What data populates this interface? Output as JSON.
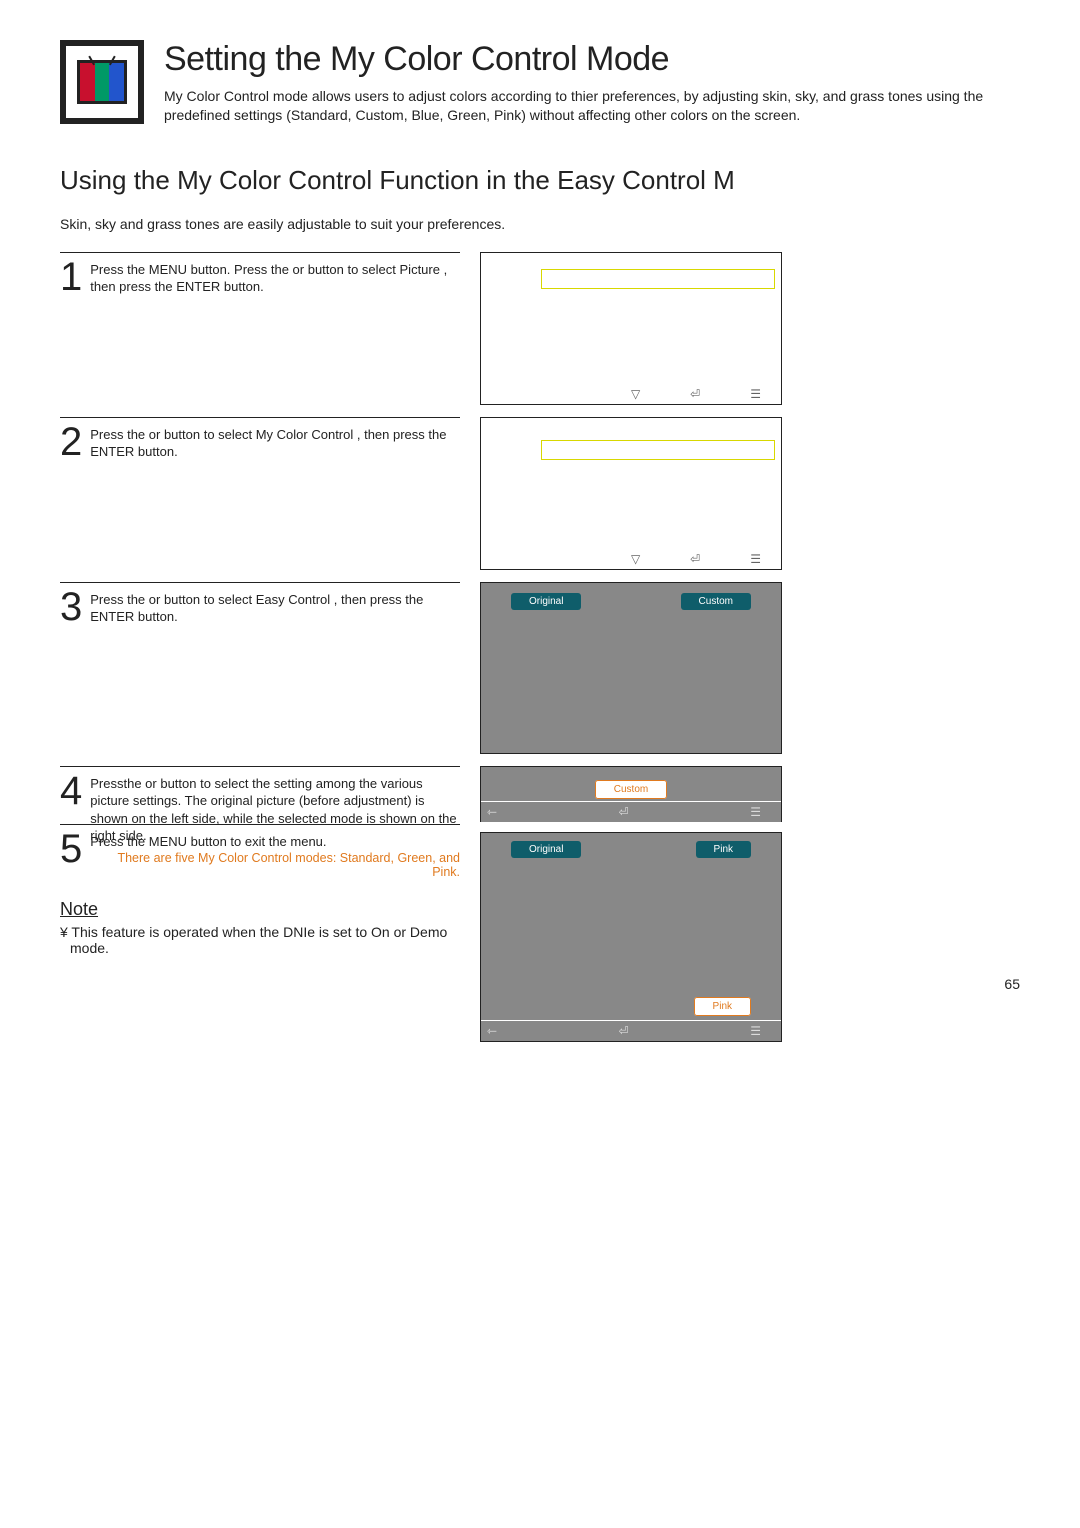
{
  "header": {
    "title": "Setting the My Color Control Mode",
    "description": "My Color Control mode allows users to adjust colors according to thier preferences, by adjusting skin, sky, and grass tones using the predefined settings (Standard, Custom, Blue, Green, Pink) without affecting other colors on the screen."
  },
  "section_title": "Using the My Color Control Function in the Easy Control M",
  "intro": "Skin, sky and grass tones are easily adjustable to suit your preferences.",
  "steps": [
    {
      "num": "1",
      "text": "Press the MENU button. Press the  or      button to select  Picture , then press the ENTER button."
    },
    {
      "num": "2",
      "text": "Press the    or      button to select  My Color Control , then press the ENTER button."
    },
    {
      "num": "3",
      "text": "Press the    or      button to select  Easy Control , then press the ENTER button."
    },
    {
      "num": "4",
      "text": "Pressthe     or      button to select the setting among the various picture settings. The original picture (before adjustment) is shown on the left side, while the selected mode is shown on the right side.",
      "orange": "There are five My Color Control modes: Standard, Green, and Pink."
    },
    {
      "num": "5",
      "text": "Press the MENU button to exit the menu."
    }
  ],
  "previews": {
    "p3": {
      "left": "Original",
      "right": "Custom"
    },
    "p4_top": {
      "label": "Custom"
    },
    "p4_bottom": {
      "left": "Original",
      "right": "Pink",
      "footer": "Pink"
    }
  },
  "note": {
    "heading": "Note",
    "body": "¥   This feature is operated when the  DNIe  is set to  On  or  Demo  mode."
  },
  "page_number": "65"
}
